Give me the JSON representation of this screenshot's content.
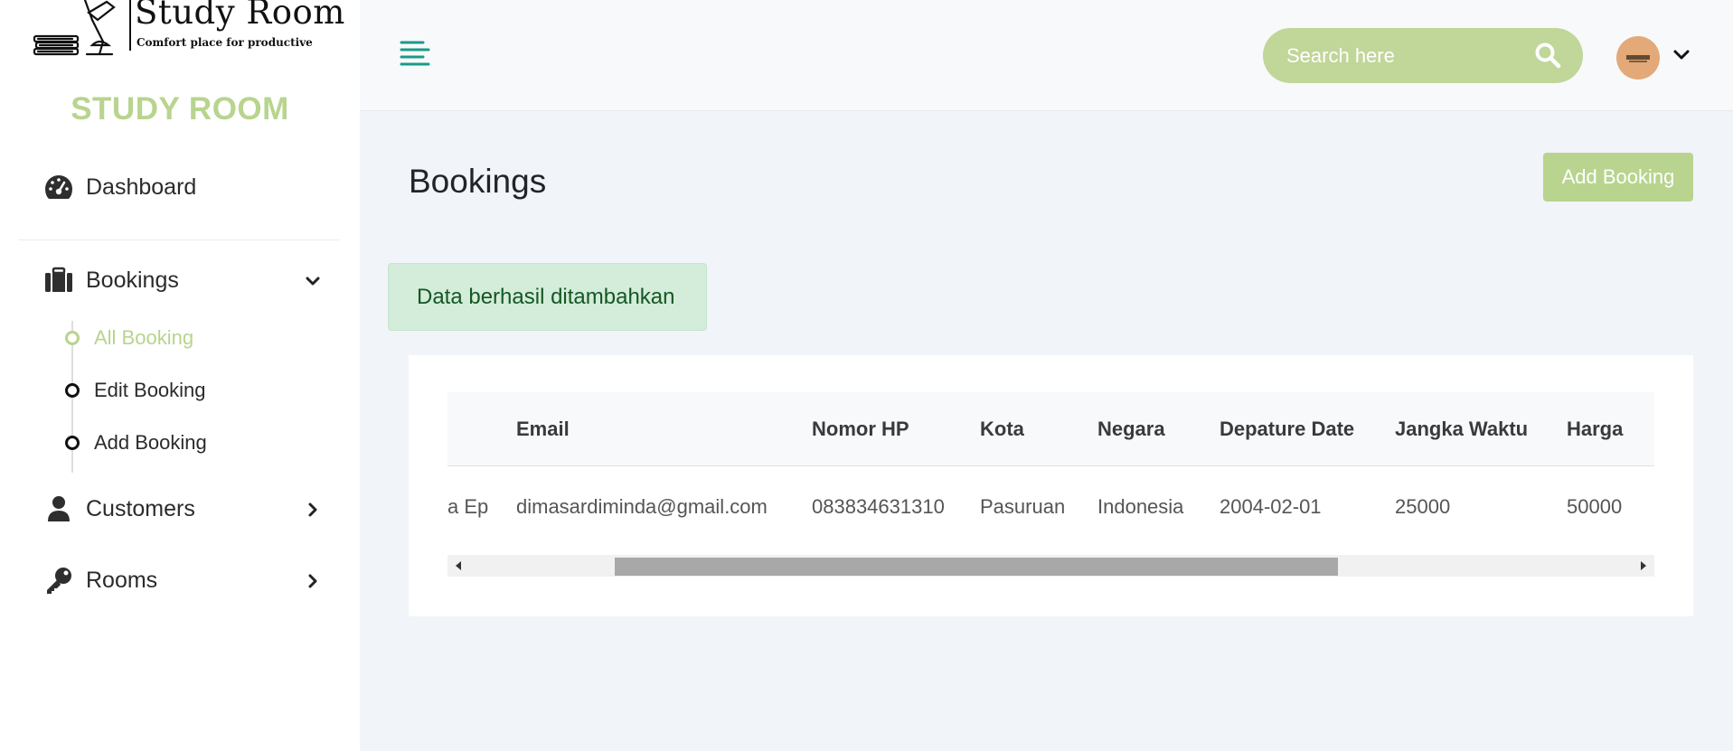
{
  "sidebar": {
    "logo": {
      "title": "Study Room",
      "subtitle": "Comfort place for productive"
    },
    "brand": "STUDY ROOM",
    "dashboard": {
      "label": "Dashboard",
      "icon": "speedometer-icon"
    },
    "bookings": {
      "label": "Bookings",
      "icon": "suitcase-icon",
      "expanded": true,
      "items": [
        {
          "label": "All Booking",
          "active": true
        },
        {
          "label": "Edit Booking",
          "active": false
        },
        {
          "label": "Add Booking",
          "active": false
        }
      ]
    },
    "customers": {
      "label": "Customers",
      "icon": "user-icon"
    },
    "rooms": {
      "label": "Rooms",
      "icon": "key-icon"
    }
  },
  "topbar": {
    "menu_icon": "hamburger-icon",
    "search": {
      "placeholder": "Search here",
      "value": ""
    }
  },
  "main": {
    "title": "Bookings",
    "add_button": "Add Booking",
    "alert": "Data berhasil ditambahkan",
    "table": {
      "columns": [
        "Email",
        "Nomor HP",
        "Kota",
        "Negara",
        "Depature Date",
        "Jangka Waktu",
        "Harga"
      ],
      "rows": [
        {
          "cut_cell": "a Ep",
          "cells": [
            "dimasardiminda@gmail.com",
            "083834631310",
            "Pasuruan",
            "Indonesia",
            "2004-02-01",
            "25000",
            "50000"
          ]
        }
      ]
    }
  },
  "colors": {
    "accent": "#b8d48e",
    "search_bg": "#c1d699",
    "alert_bg": "#d4ecda",
    "alert_text": "#155724",
    "menu_icon": "#1a9a8a",
    "avatar": "#e3a978"
  }
}
